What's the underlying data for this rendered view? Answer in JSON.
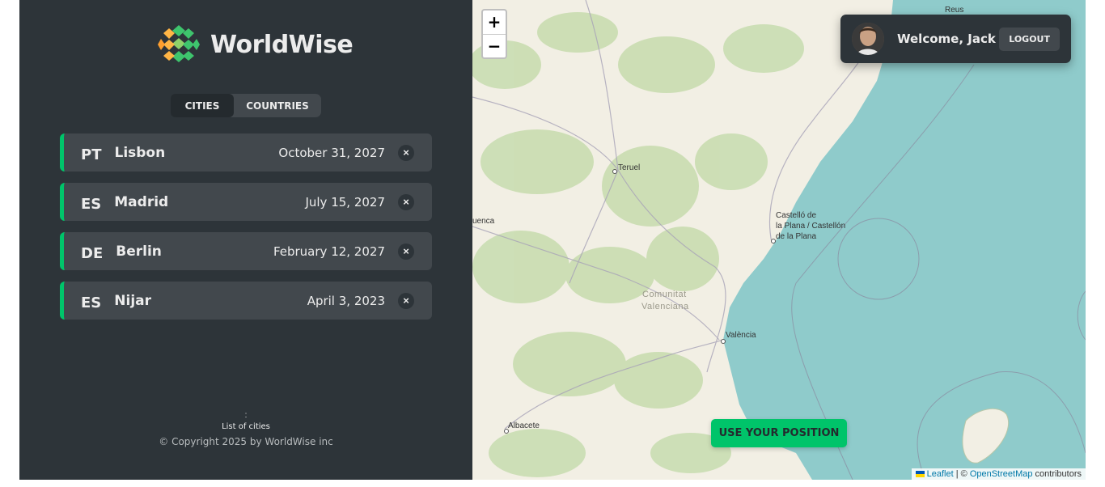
{
  "app": {
    "name": "WorldWise",
    "brand_color": "#00c46a",
    "sidebar_bg": "#2d3439"
  },
  "tabs": {
    "cities": "CITIES",
    "countries": "COUNTRIES"
  },
  "cities": [
    {
      "code": "PT",
      "name": "Lisbon",
      "date": "October 31, 2027",
      "delete_label": "×"
    },
    {
      "code": "ES",
      "name": "Madrid",
      "date": "July 15, 2027",
      "delete_label": "×"
    },
    {
      "code": "DE",
      "name": "Berlin",
      "date": "February 12, 2027",
      "delete_label": "×"
    },
    {
      "code": "ES",
      "name": "Nijar",
      "date": "April 3, 2023",
      "delete_label": "×"
    }
  ],
  "footer": {
    "separator": ":",
    "label": "List of cities",
    "copyright": "© Copyright 2025 by WorldWise inc"
  },
  "map": {
    "zoom_in": "+",
    "zoom_out": "−",
    "use_position": "USE YOUR POSITION",
    "labels": {
      "reus": "Reus",
      "teruel": "Teruel",
      "cuenca": "uenca",
      "castello_1": "Castelló de",
      "castello_2": "la Plana / Castellón",
      "castello_3": "de la Plana",
      "comunitat_1": "Comunitat",
      "comunitat_2": "Valenciana",
      "valencia": "València",
      "albacete": "Albacete"
    },
    "attribution": {
      "leaflet": "Leaflet",
      "sep": " | © ",
      "osm": "OpenStreetMap",
      "contributors": " contributors"
    }
  },
  "user": {
    "welcome": "Welcome, Jack",
    "logout": "LOGOUT"
  }
}
